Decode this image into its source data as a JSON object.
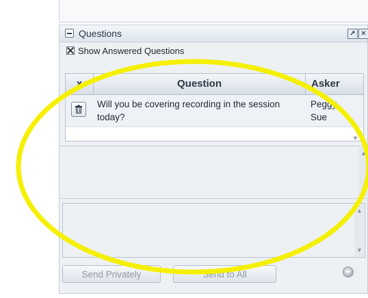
{
  "panel": {
    "title": "Questions",
    "show_answered_label": "Show Answered Questions"
  },
  "table": {
    "columns": {
      "x": "x",
      "question": "Question",
      "asker": "Asker"
    },
    "rows": [
      {
        "question": "Will you be covering recording in the session today?",
        "asker": "Peggy Sue"
      }
    ]
  },
  "buttons": {
    "send_privately": "Send Privately",
    "send_to_all": "Send to All"
  },
  "icons": {
    "collapse": "collapse-icon",
    "detach": "detach-icon",
    "close": "close-icon",
    "delete": "trash-icon",
    "options": "options-icon"
  },
  "colors": {
    "highlight": "#f5ef00",
    "panel_bg": "#eef1f4",
    "header_gradient_top": "#f4f7fa",
    "header_gradient_bottom": "#dde4ec"
  }
}
